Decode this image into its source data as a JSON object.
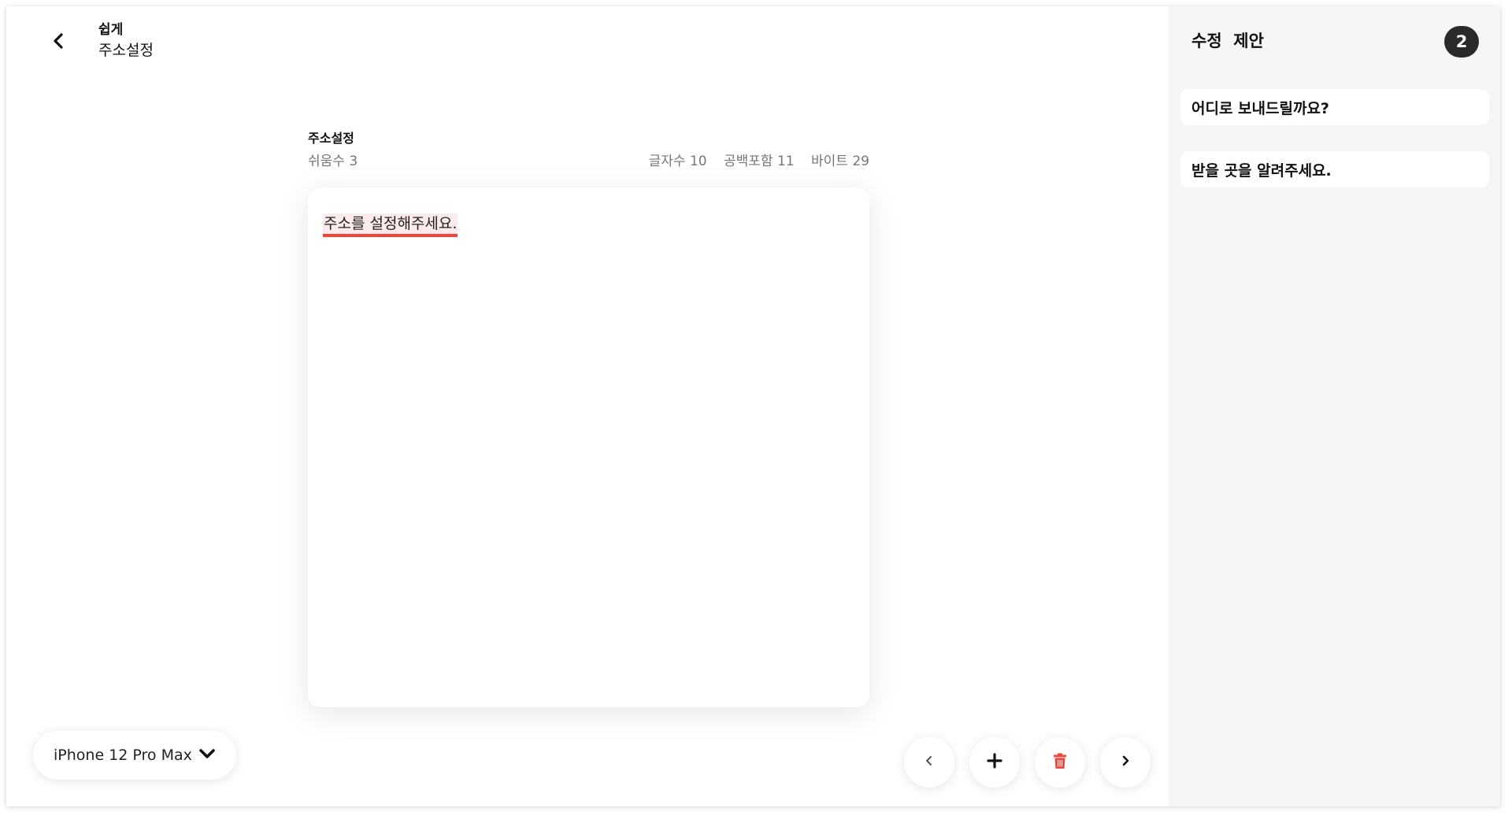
{
  "header": {
    "title": "쉽게",
    "subtitle": "주소설정"
  },
  "editor": {
    "label": "주소설정",
    "stats": {
      "rest_count": "쉬움수 3",
      "char_count": "글자수 10",
      "with_spaces": "공백포함 11",
      "bytes": "바이트 29"
    },
    "text": "주소를 설정해주세요."
  },
  "device_select": {
    "selected": "iPhone 12 Pro Max"
  },
  "sidebar": {
    "title": "수정  제안",
    "badge_count": "2",
    "suggestions": [
      "어디로 보내드릴까요?",
      "받을 곳을 알려주세요."
    ]
  },
  "colors": {
    "highlight_underline": "#f04438",
    "highlight_bg": "#fdeaea",
    "delete_icon": "#f04438",
    "badge_bg": "#2a2a2a",
    "sidebar_bg": "#f6f6f6"
  },
  "icons": {
    "back": "chevron-left-icon",
    "dropdown": "chevron-down-icon",
    "prev": "chevron-left-icon",
    "add": "plus-icon",
    "delete": "trash-icon",
    "next": "chevron-right-icon"
  }
}
